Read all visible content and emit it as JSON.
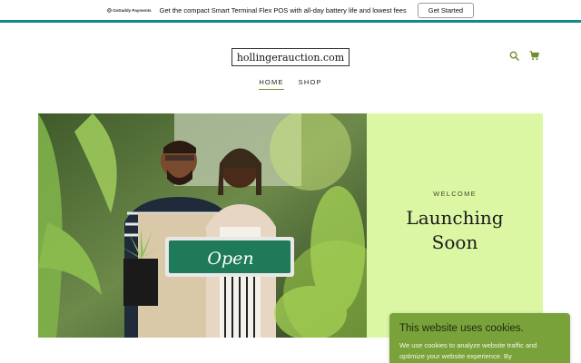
{
  "promo": {
    "logo_text": "GoDaddy Payments",
    "message": "Get the compact Smart Terminal Flex POS with all-day battery life and lowest fees",
    "cta_label": "Get Started"
  },
  "header": {
    "site_title": "hollingerauction.com",
    "icons": [
      "search-icon",
      "cart-icon"
    ],
    "accent_color": "#6f8f2a"
  },
  "nav": {
    "items": [
      {
        "label": "HOME",
        "active": true
      },
      {
        "label": "SHOP",
        "active": false
      }
    ]
  },
  "hero": {
    "eyebrow": "WELCOME",
    "title_line1": "Launching",
    "title_line2": "Soon",
    "sign_text": "Open",
    "panel_color": "#dcf7a4"
  },
  "cookie_banner": {
    "title": "This website uses cookies.",
    "body": "We use cookies to analyze website traffic and optimize your website experience. By",
    "background_color": "#7aa23a"
  }
}
